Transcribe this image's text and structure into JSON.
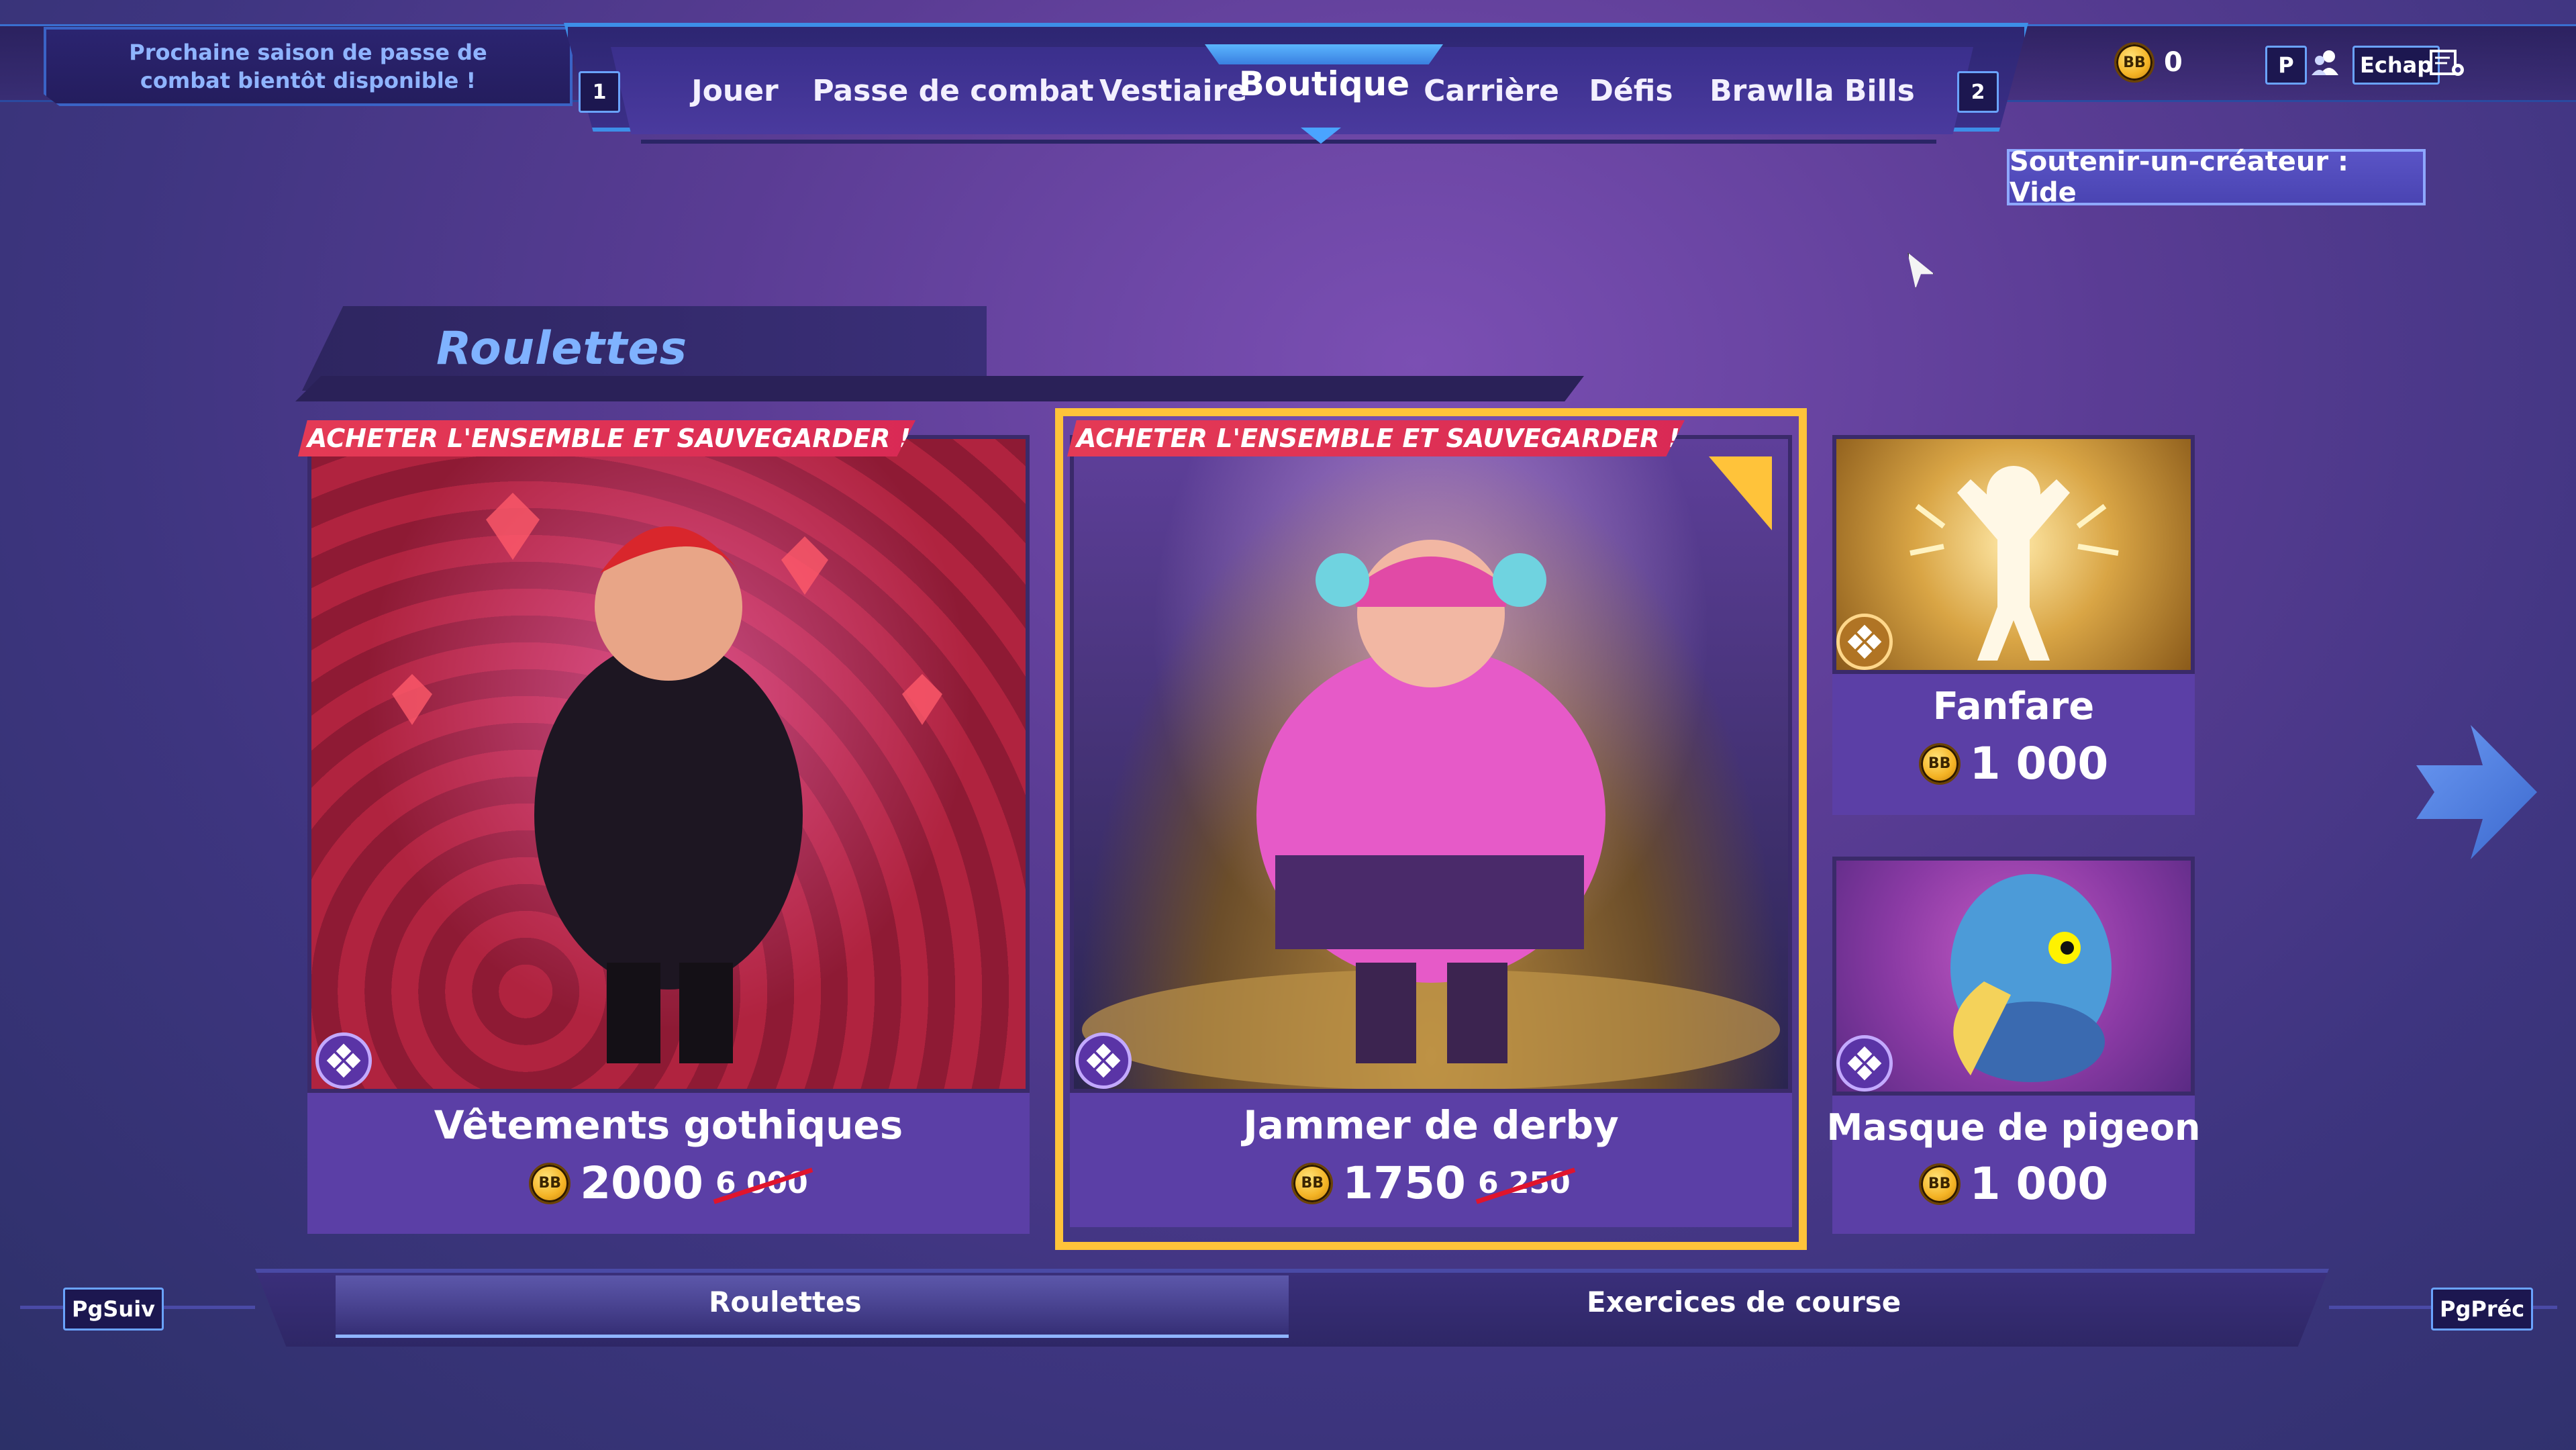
{
  "header": {
    "season_notice": "Prochaine saison de passe de combat bientôt disponible !",
    "nav_prev_key": "1",
    "nav_next_key": "2",
    "tabs": [
      {
        "label": "Jouer"
      },
      {
        "label": "Passe de combat"
      },
      {
        "label": "Vestiaire"
      },
      {
        "label": "Boutique",
        "active": true
      },
      {
        "label": "Carrière"
      },
      {
        "label": "Défis"
      },
      {
        "label": "Brawlla Bills"
      }
    ],
    "currency_icon": "brawlla-bills-coin-icon",
    "currency_value": "0",
    "key_p": "P",
    "friends_icon": "friends-icon",
    "key_escape": "Echap",
    "settings_icon": "settings-icon"
  },
  "support_creator": {
    "label": "Soutenir-un-créateur : Vide"
  },
  "section": {
    "title": "Roulettes"
  },
  "cards": [
    {
      "name": "Vêtements gothiques",
      "price": "2000",
      "old_price": "6 000",
      "ribbon": "ACHETER L'ENSEMBLE ET SAUVEGARDER !",
      "rarity": "epic"
    },
    {
      "name": "Jammer de derby",
      "price": "1750",
      "old_price": "6 250",
      "ribbon": "ACHETER L'ENSEMBLE ET SAUVEGARDER !",
      "rarity": "epic",
      "selected": true
    },
    {
      "name": "Fanfare",
      "price": "1 000",
      "rarity": "legendary"
    },
    {
      "name": "Masque de pigeon",
      "price": "1 000",
      "rarity": "epic"
    }
  ],
  "bottom_nav": {
    "left_key": "PgSuiv",
    "right_key": "PgPréc",
    "tabs": [
      {
        "label": "Roulettes",
        "active": true
      },
      {
        "label": "Exercices de course"
      }
    ]
  },
  "coin_label": "BB",
  "colors": {
    "accent_gold": "#ffc33a",
    "ribbon_red": "#e43a55",
    "card_footer": "#5b3fa6",
    "nav_blue": "#3d8fe8"
  }
}
